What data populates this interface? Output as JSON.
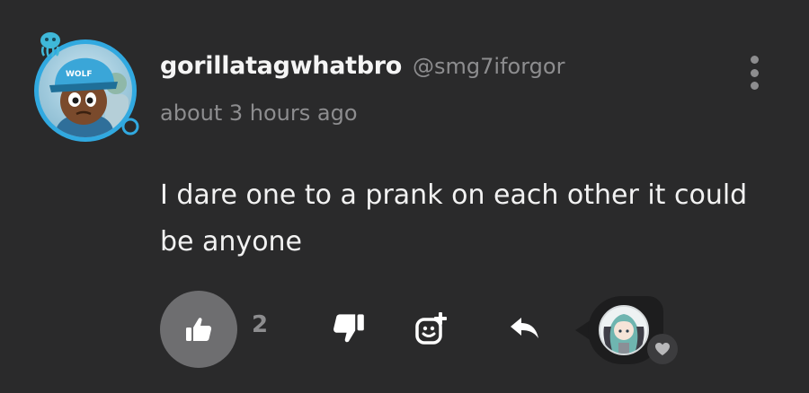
{
  "comment": {
    "username": "gorillatagwhatbro",
    "handle": "@smg7iforgor",
    "timestamp": "about 3 hours ago",
    "body": "I dare one to a prank on each other it could be anyone",
    "avatar_hat_text": "WOLF"
  },
  "actions": {
    "like_count": "2",
    "like_icon": "thumbs-up-icon",
    "dislike_icon": "thumbs-down-icon",
    "react_icon": "add-reaction-icon",
    "reply_icon": "reply-icon",
    "more_icon": "more-vertical-icon"
  },
  "creator_heart": {
    "icon": "heart-icon"
  },
  "colors": {
    "background": "#2a2a2b",
    "avatar_ring": "#31a9e0",
    "like_button_bg": "#6e6e70",
    "muted_text": "#8d8d8f"
  }
}
